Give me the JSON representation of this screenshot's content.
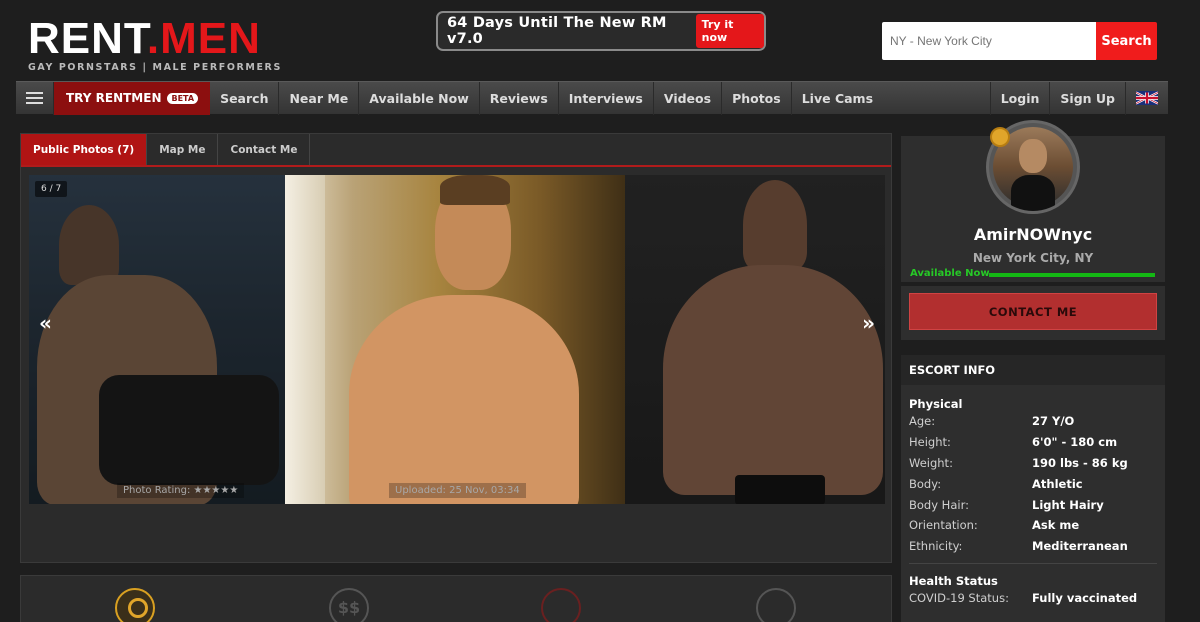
{
  "header": {
    "logo_main": "RENT",
    "logo_dot": ".",
    "logo_accent": "MEN",
    "logo_sub": "GAY PORNSTARS | MALE PERFORMERS",
    "promo_text": "64 Days Until The New RM v7.0",
    "promo_button": "Try it now",
    "search_placeholder": "NY - New York City",
    "search_button": "Search"
  },
  "nav": {
    "try_label": "TRY RENTMEN",
    "beta_badge": "BETA",
    "items": [
      "Search",
      "Near Me",
      "Available Now",
      "Reviews",
      "Interviews",
      "Videos",
      "Photos",
      "Live Cams"
    ],
    "login": "Login",
    "signup": "Sign Up"
  },
  "tabs": [
    "Public Photos (7)",
    "Map Me",
    "Contact Me"
  ],
  "gallery": {
    "counter": "6 / 7",
    "prev": "«",
    "next": "»",
    "rating_label": "Photo Rating: ★★★★★",
    "uploaded_label": "Uploaded: 25 Nov, 03:34"
  },
  "bottom_icons": {
    "dollar": "$$"
  },
  "profile": {
    "name": "AmirNOWnyc",
    "location": "New York City, NY",
    "availability": "Available Now",
    "contact_button": "CONTACT ME"
  },
  "escort_info": {
    "title": "ESCORT INFO",
    "physical_title": "Physical",
    "physical": [
      {
        "k": "Age:",
        "v": "27 Y/O"
      },
      {
        "k": "Height:",
        "v": "6'0\" - 180 cm"
      },
      {
        "k": "Weight:",
        "v": "190 lbs - 86 kg"
      },
      {
        "k": "Body:",
        "v": "Athletic"
      },
      {
        "k": "Body Hair:",
        "v": "Light Hairy"
      },
      {
        "k": "Orientation:",
        "v": "Ask me"
      },
      {
        "k": "Ethnicity:",
        "v": "Mediterranean"
      }
    ],
    "health_title": "Health Status",
    "health": [
      {
        "k": "COVID-19 Status:",
        "v": "Fully vaccinated"
      }
    ]
  },
  "colors": {
    "brand_red": "#e4171a",
    "available_green": "#14b814",
    "contact_red": "#b22f2f"
  }
}
